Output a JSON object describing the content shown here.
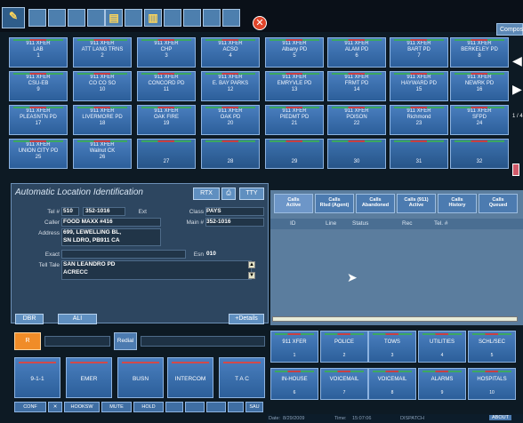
{
  "toolbar": {
    "close_label": "✕",
    "compose_label": "Compose"
  },
  "transfer_grid": [
    {
      "label": "911 XFER",
      "sub": "LAB",
      "num": "1"
    },
    {
      "label": "911 XFER",
      "sub": "ATT LANG TRNS",
      "num": "2"
    },
    {
      "label": "911 XFER",
      "sub": "CHP",
      "num": "3"
    },
    {
      "label": "911 XFER",
      "sub": "ACSO",
      "num": "4"
    },
    {
      "label": "911 XFER",
      "sub": "Albany PD",
      "num": "5"
    },
    {
      "label": "911 XFER",
      "sub": "ALAM PD",
      "num": "6"
    },
    {
      "label": "911 XFER",
      "sub": "BART PD",
      "num": "7"
    },
    {
      "label": "911 XFER",
      "sub": "BERKELEY PD",
      "num": "8"
    },
    {
      "label": "911 XFER",
      "sub": "CSU-EB",
      "num": "9"
    },
    {
      "label": "911 XFER",
      "sub": "CO CO SO",
      "num": "10"
    },
    {
      "label": "911 XFER",
      "sub": "CONCORD PD",
      "num": "11"
    },
    {
      "label": "911 XFER",
      "sub": "E. BAY PARKS",
      "num": "12"
    },
    {
      "label": "911 XFER",
      "sub": "EMRYVLE PD",
      "num": "13"
    },
    {
      "label": "911 XFER",
      "sub": "FRMT PD",
      "num": "14"
    },
    {
      "label": "911 XFER",
      "sub": "HAYWARD PD",
      "num": "15"
    },
    {
      "label": "911 XFER",
      "sub": "NEWRK PD",
      "num": "16"
    },
    {
      "label": "911 XFER",
      "sub": "PLEASNTN PD",
      "num": "17"
    },
    {
      "label": "911 XFER",
      "sub": "LIVERMORE PD",
      "num": "18"
    },
    {
      "label": "911 XFER",
      "sub": "OAK FIRE",
      "num": "19"
    },
    {
      "label": "911 XFER",
      "sub": "OAK PD",
      "num": "20"
    },
    {
      "label": "911 XFER",
      "sub": "PIEDMT PD",
      "num": "21"
    },
    {
      "label": "911 XFER",
      "sub": "POISON",
      "num": "22"
    },
    {
      "label": "911 XFER",
      "sub": "Richmond",
      "num": "23"
    },
    {
      "label": "911 XFER",
      "sub": "SFPD",
      "num": "24"
    },
    {
      "label": "911 XFER",
      "sub": "UNION CITY PD",
      "num": "25"
    },
    {
      "label": "911 XFER",
      "sub": "Walnut CK",
      "num": "26"
    },
    {
      "label": "",
      "sub": "",
      "num": "27"
    },
    {
      "label": "",
      "sub": "",
      "num": "28"
    },
    {
      "label": "",
      "sub": "",
      "num": "29"
    },
    {
      "label": "",
      "sub": "",
      "num": "30"
    },
    {
      "label": "",
      "sub": "",
      "num": "31"
    },
    {
      "label": "",
      "sub": "",
      "num": "32"
    }
  ],
  "page_indicator": "1 / 4",
  "ali": {
    "title": "Automatic Location Identification",
    "rtx_label": "RTX",
    "tty_label": "TTY",
    "tel_label": "Tel #",
    "tel_area": "510",
    "tel_number": "352-1016",
    "ext_label": "Ext",
    "class_label": "Class",
    "class_value": "PAYS",
    "caller_label": "Caller",
    "caller_value": "FOOD MAXX #416",
    "main_label": "Main #",
    "main_value": "352-1016",
    "address_label": "Address",
    "address_line1": "699, LEWELLING BL,",
    "address_line2": "SN LDRO, PB911 CA",
    "exact_label": "Exact",
    "esn_label": "Esn",
    "esn_value": "010",
    "telltale_label": "Tell Tale",
    "telltale_line1": "SAN LEANDRO PD",
    "telltale_line2": "ACRECC",
    "dbr_label": "DBR",
    "ali_label": "ALI",
    "details_label": "+Details"
  },
  "calls": {
    "tabs": [
      {
        "label1": "Calls",
        "label2": "Active"
      },
      {
        "label1": "Calls",
        "label2": "Rlsd (Agent)"
      },
      {
        "label1": "Calls",
        "label2": "Abandoned"
      },
      {
        "label1": "Calls (911)",
        "label2": "Active"
      },
      {
        "label1": "Calls",
        "label2": "History"
      },
      {
        "label1": "Calls",
        "label2": "Queued"
      }
    ],
    "columns": [
      "ID",
      "Line",
      "Status",
      "Rec",
      "Tel. #"
    ]
  },
  "bottom_left": {
    "r_label": "R",
    "redial_label": "Redial",
    "lines": [
      "9-1-1",
      "EMER",
      "BUSN",
      "INTERCOM",
      "T A C"
    ],
    "small_buttons": [
      "CONF",
      "✕",
      "HOOKSW",
      "MUTE",
      "HOLD",
      "",
      "",
      "",
      "",
      "SAU"
    ]
  },
  "quick_dial": [
    {
      "label": "911 XFER",
      "num": "1"
    },
    {
      "label": "POLICE",
      "num": "2"
    },
    {
      "label": "TOWS",
      "num": "3"
    },
    {
      "label": "UTILITIES",
      "num": "4"
    },
    {
      "label": "SCHL/SEC",
      "num": "5"
    },
    {
      "label": "IN-HOUSE",
      "num": "6"
    },
    {
      "label": "VOICEMAIL",
      "num": "7"
    },
    {
      "label": "VOICEMAIL",
      "num": "8"
    },
    {
      "label": "ALARMS",
      "num": "9"
    },
    {
      "label": "HOSPITALS",
      "num": "10"
    }
  ],
  "status_bar": {
    "date_label": "Date:",
    "date_value": "8/29/2009",
    "time_label": "Time:",
    "time_value": "15:07:06",
    "mode": "DISPATCH",
    "about_label": "ABOUT"
  }
}
